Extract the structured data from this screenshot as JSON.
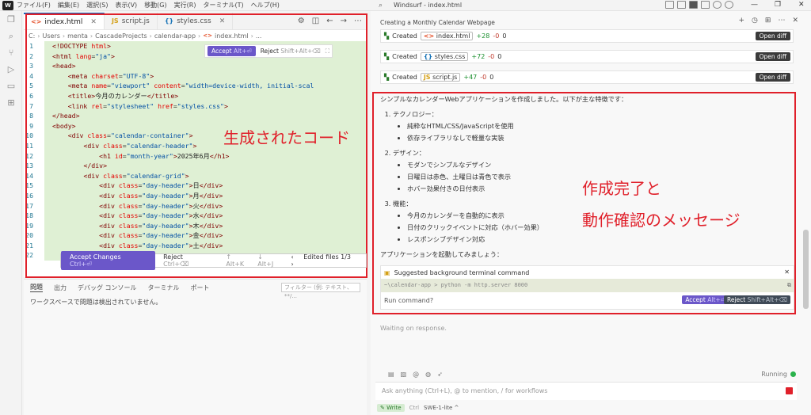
{
  "app": {
    "menus": [
      "ファイル(F)",
      "編集(E)",
      "選択(S)",
      "表示(V)",
      "移動(G)",
      "実行(R)",
      "ターミナル(T)",
      "ヘルプ(H)"
    ],
    "window_title": "Windsurf - index.html",
    "win_buttons": {
      "min": "—",
      "max": "❐",
      "close": "✕"
    }
  },
  "editor": {
    "tabs": [
      {
        "label": "index.html",
        "icon": "<>",
        "icon_color": "#e44d26"
      },
      {
        "label": "script.js",
        "icon": "JS",
        "icon_color": "#d4a017"
      },
      {
        "label": "styles.css",
        "icon": "{}",
        "icon_color": "#1572b6"
      }
    ],
    "breadcrumb": [
      "C:",
      "Users",
      "menta",
      "CascadeProjects",
      "calendar-app",
      "index.html",
      "..."
    ],
    "line_numbers": [
      "1",
      "2",
      "3",
      "4",
      "5",
      "6",
      "7",
      "8",
      "9",
      "10",
      "11",
      "12",
      "13",
      "14",
      "15",
      "16",
      "17",
      "18",
      "19",
      "20",
      "21",
      "22"
    ],
    "inline_accept": {
      "accept": "Accept",
      "accept_key": "Alt+⏎",
      "reject": "Reject",
      "reject_key": "Shift+Alt+⌫"
    },
    "changes_bar": {
      "accept": "Accept Changes",
      "accept_key": "Ctrl+⏎",
      "reject": "Reject",
      "reject_key": "Ctrl+⌫",
      "prev": "↑ Alt+K",
      "next": "↓ Alt+J",
      "edited": "Edited files 1/3"
    }
  },
  "panel": {
    "tabs": [
      "問題",
      "出力",
      "デバッグ コンソール",
      "ターミナル",
      "ポート"
    ],
    "filter_placeholder": "フィルター (例: テキスト、**/...",
    "message": "ワークスペースで問題は検出されていません。"
  },
  "annotations": {
    "code": "生成されたコード",
    "message_line1": "作成完了と",
    "message_line2": "動作確認のメッセージ"
  },
  "chat": {
    "title": "Creating a Monthly Calendar Webpage",
    "files": [
      {
        "action": "Created",
        "icon": "<>",
        "icon_color": "#e44d26",
        "name": "index.html",
        "added": "+28",
        "removed": "-0",
        "extra": "0",
        "button": "Open diff"
      },
      {
        "action": "Created",
        "icon": "{}",
        "icon_color": "#1572b6",
        "name": "styles.css",
        "added": "+72",
        "removed": "-0",
        "extra": "0",
        "button": "Open diff"
      },
      {
        "action": "Created",
        "icon": "JS",
        "icon_color": "#d4a017",
        "name": "script.js",
        "added": "+47",
        "removed": "-0",
        "extra": "0",
        "button": "Open diff"
      }
    ],
    "summary_intro": "シンプルなカレンダーWebアプリケーションを作成しました。以下が主な特徴です：",
    "sections": [
      {
        "title": "テクノロジー：",
        "items": [
          "純粋なHTML/CSS/JavaScriptを使用",
          "依存ライブラリなしで軽量な実装"
        ]
      },
      {
        "title": "デザイン：",
        "items": [
          "モダンでシンプルなデザイン",
          "日曜日は赤色、土曜日は青色で表示",
          "ホバー効果付きの日付表示"
        ]
      },
      {
        "title": "機能：",
        "items": [
          "今月のカレンダーを自動的に表示",
          "日付のクリックイベントに対応（ホバー効果）",
          "レスポンシブデザイン対応"
        ]
      }
    ],
    "summary_outro": "アプリケーションを起動してみましょう：",
    "terminal": {
      "title": "Suggested background terminal command",
      "command": "~\\calendar-app > python -m http.server 8000",
      "prompt": "Run command?",
      "accept": "Accept",
      "accept_key": "Alt+⏎",
      "reject": "Reject",
      "reject_key": "Shift+Alt+⌫"
    },
    "waiting": "Waiting on response.",
    "status": "Running",
    "input_placeholder": "Ask anything (Ctrl+L), @ to mention, / for workflows",
    "mode": "Write",
    "mode_key": "Ctrl",
    "model": "SWE-1-lite"
  },
  "colors": {
    "accent": "#6b57c9",
    "annotation": "#e0202a",
    "added": "#1a8f2e"
  }
}
